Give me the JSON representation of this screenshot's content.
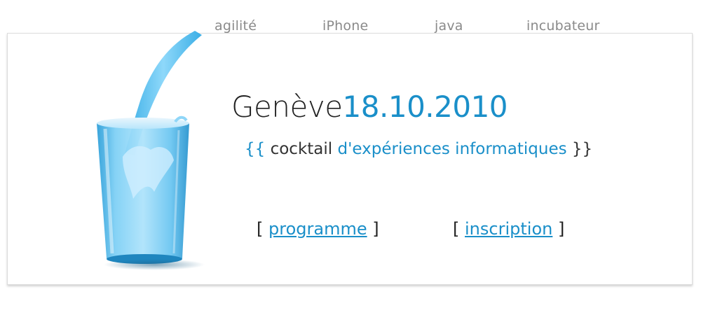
{
  "nav": {
    "items": [
      {
        "label": "agilité"
      },
      {
        "label": "iPhone"
      },
      {
        "label": "java"
      },
      {
        "label": "incubateur"
      }
    ]
  },
  "hero": {
    "city": "Genève",
    "date": "18.10.2010",
    "tagline": {
      "open": "{{",
      "plain": "cocktail",
      "accent": "d'expériences informatiques",
      "close": "}}"
    }
  },
  "actions": {
    "bracket_open": "[",
    "bracket_close": "]",
    "programme_label": "programme",
    "inscription_label": "inscription"
  },
  "colors": {
    "accent": "#1a8fc9",
    "nav_text": "#8a8a8a",
    "dark_text": "#222222",
    "milk_blue": "#66c4ef"
  },
  "icons": {
    "illustration": "milk-glass-illustration"
  }
}
